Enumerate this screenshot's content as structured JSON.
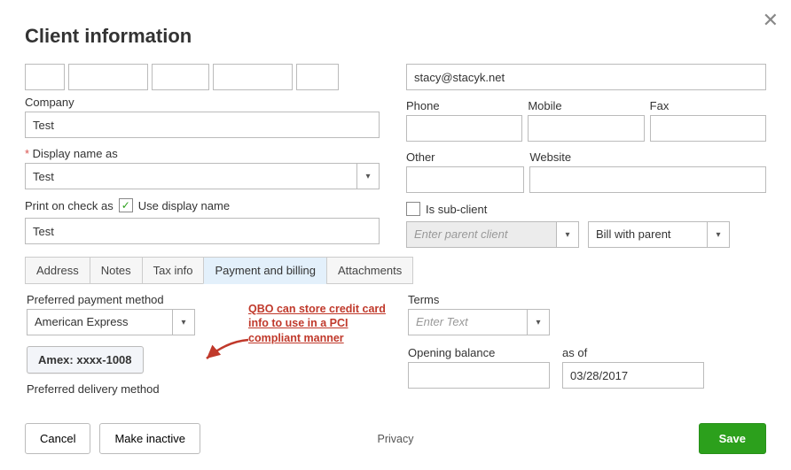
{
  "header": {
    "title": "Client information"
  },
  "left": {
    "companyLabel": "Company",
    "companyValue": "Test",
    "displayAsLabel": "Display name as",
    "displayAsValue": "Test",
    "printLabel": "Print on check as",
    "useDisplayName": "Use display name",
    "printValue": "Test"
  },
  "right": {
    "email": "stacy@stacyk.net",
    "phoneLabel": "Phone",
    "mobileLabel": "Mobile",
    "faxLabel": "Fax",
    "otherLabel": "Other",
    "websiteLabel": "Website",
    "isSubClient": "Is sub-client",
    "parentPlaceholder": "Enter parent client",
    "billWith": "Bill with parent"
  },
  "tabs": {
    "address": "Address",
    "notes": "Notes",
    "taxinfo": "Tax info",
    "payment": "Payment and billing",
    "attachments": "Attachments"
  },
  "payment": {
    "pmLabel": "Preferred payment method",
    "pmValue": "American Express",
    "cardBtn": "Amex: xxxx-1008",
    "delLabel": "Preferred delivery method",
    "termsLabel": "Terms",
    "termsPlaceholder": "Enter Text",
    "obLabel": "Opening balance",
    "asofLabel": "as of",
    "asofValue": "03/28/2017"
  },
  "annotation": {
    "l1": "QBO can store credit card",
    "l2": "info to use in a PCI",
    "l3": "compliant manner"
  },
  "footer": {
    "cancel": "Cancel",
    "inactive": "Make inactive",
    "privacy": "Privacy",
    "save": "Save"
  }
}
